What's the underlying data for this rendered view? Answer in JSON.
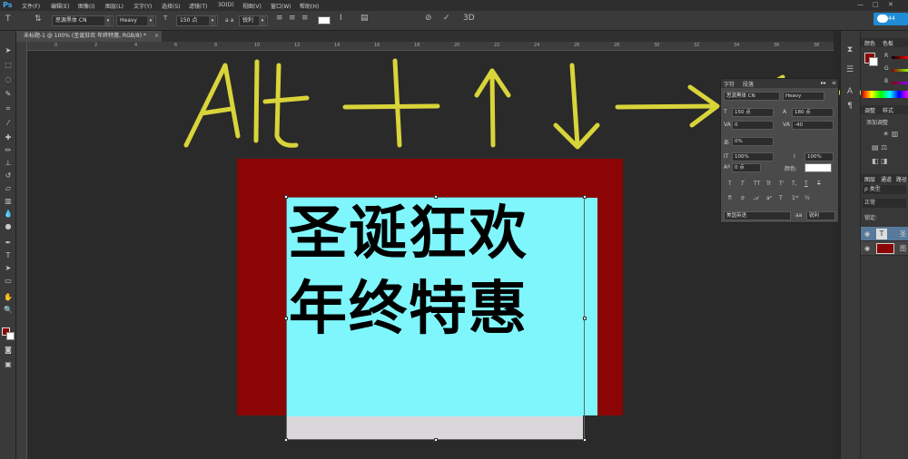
{
  "app": {
    "logo": "Ps"
  },
  "menu": [
    "文件(F)",
    "编辑(E)",
    "图像(I)",
    "图层(L)",
    "文字(Y)",
    "选择(S)",
    "滤镜(T)",
    "3D(D)",
    "视图(V)",
    "窗口(W)",
    "帮助(H)"
  ],
  "options": {
    "font_family": "思源黑体 CN",
    "font_style": "Heavy",
    "font_size": "150 点",
    "aa_label": "a a",
    "aa_mode": "锐利"
  },
  "document": {
    "tab_title": "未标题-1 @ 100% (圣诞狂欢 年终特惠, RGB/8) *",
    "ruler_ticks": [
      "0",
      "2",
      "4",
      "6",
      "8",
      "10",
      "12",
      "14",
      "16",
      "18",
      "20",
      "22",
      "24",
      "26",
      "28",
      "30",
      "32",
      "34",
      "36",
      "38",
      "40"
    ]
  },
  "artwork": {
    "line1": "圣诞狂欢",
    "line2": "年终特惠",
    "annotation": "Alt + ↑ ↓ →",
    "colors": {
      "red": "#8b0504",
      "cyan": "#7ff6fb",
      "yellow": "#d8d43a"
    }
  },
  "char_panel": {
    "tabs": [
      "字符",
      "段落"
    ],
    "font_family": "思源黑体 CN",
    "font_style": "Heavy",
    "font_size": "150 点",
    "leading": "180 点",
    "kerning": "0",
    "tracking": "-40",
    "scale_pct": "0%",
    "vscale": "100%",
    "hscale": "100%",
    "baseline": "0 点",
    "color_label": "颜色:",
    "language": "美国英语",
    "aa_mode": "锐利",
    "style_buttons": [
      "T",
      "T",
      "TT",
      "Tr",
      "T'",
      "T,",
      "T",
      "T"
    ]
  },
  "right_panel": {
    "color_tabs": [
      "颜色",
      "色板"
    ],
    "adjust_tabs": [
      "调整",
      "样式"
    ],
    "adjust_label": "添加调整",
    "layers_tabs": [
      "图层",
      "通道",
      "路径"
    ],
    "kind_label": "ρ 类型",
    "blend_label": "正常",
    "lock_label": "锁定:",
    "layers": [
      {
        "name": "圣",
        "type": "text-layer"
      },
      {
        "name": "图",
        "type": "shape-layer"
      }
    ]
  },
  "window": {
    "badge": "44"
  }
}
